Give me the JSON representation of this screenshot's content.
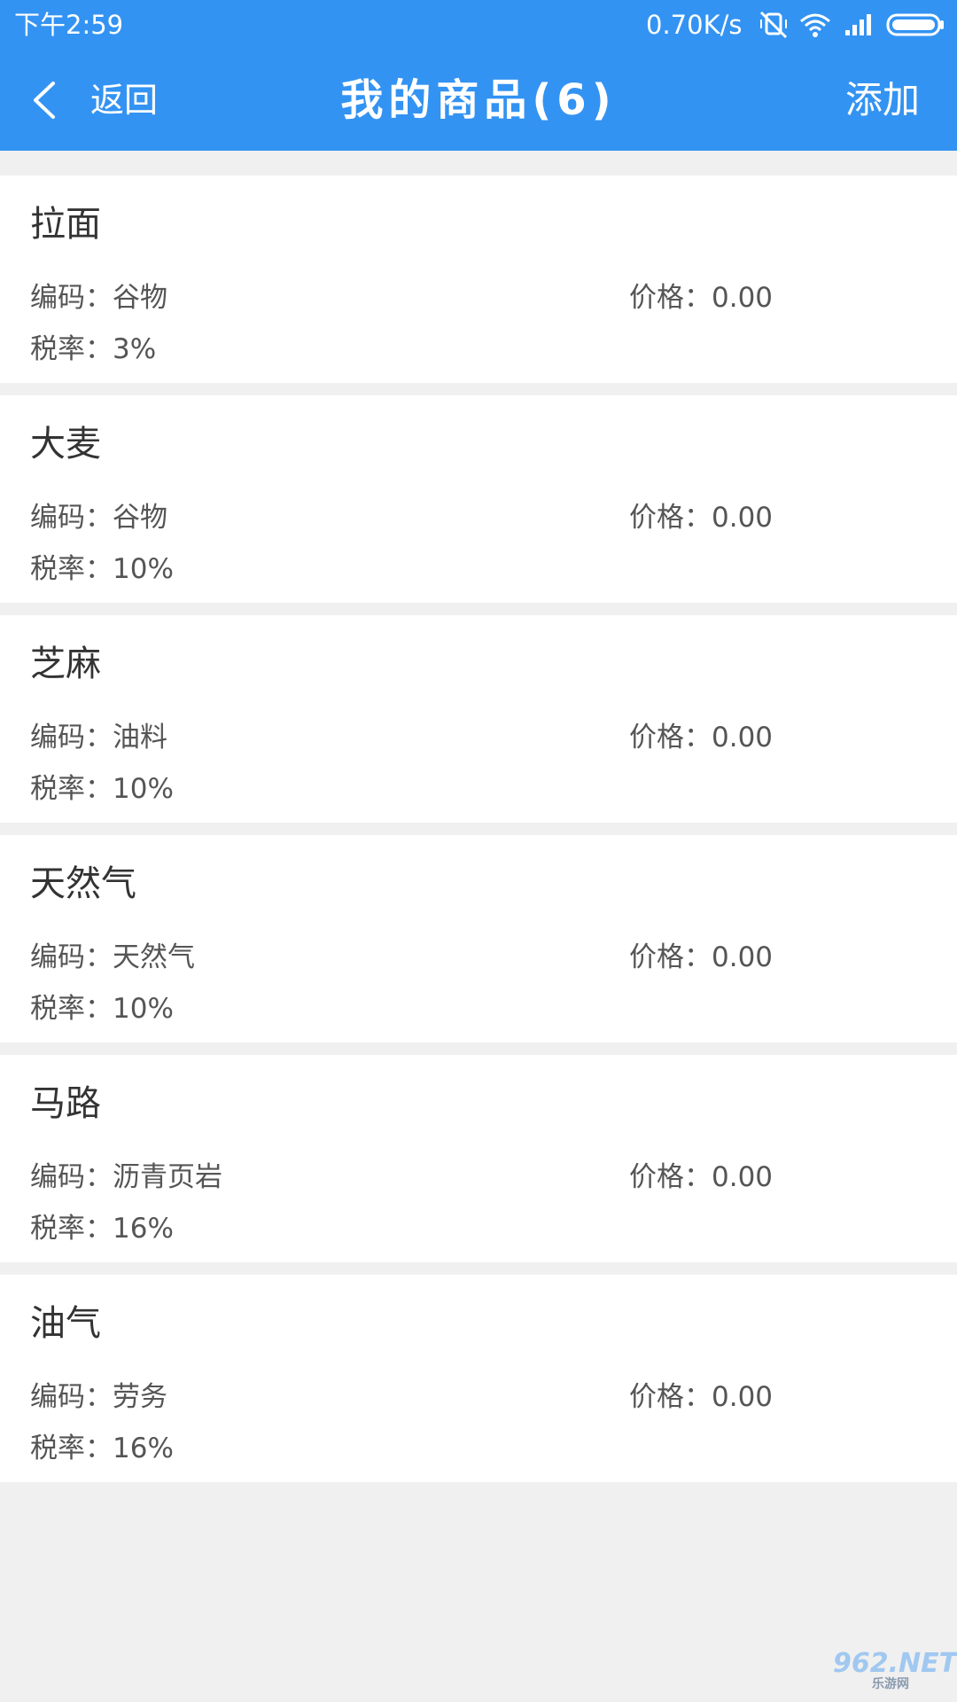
{
  "status_bar": {
    "time": "下午2:59",
    "network_speed": "0.70K/s",
    "icons": [
      "muted-vibrate-icon",
      "wifi-icon",
      "signal-icon",
      "battery-icon"
    ]
  },
  "header": {
    "back_label": "返回",
    "title": "我的商品(6)",
    "add_label": "添加"
  },
  "labels": {
    "code_prefix": "编码：",
    "price_prefix": "价格：",
    "tax_prefix": "税率："
  },
  "products": [
    {
      "name": "拉面",
      "code": "谷物",
      "price": "0.00",
      "tax": "3%"
    },
    {
      "name": "大麦",
      "code": "谷物",
      "price": "0.00",
      "tax": "10%"
    },
    {
      "name": "芝麻",
      "code": "油料",
      "price": "0.00",
      "tax": "10%"
    },
    {
      "name": "天然气",
      "code": "天然气",
      "price": "0.00",
      "tax": "10%"
    },
    {
      "name": "马路",
      "code": "沥青页岩",
      "price": "0.00",
      "tax": "16%"
    },
    {
      "name": "油气",
      "code": "劳务",
      "price": "0.00",
      "tax": "16%"
    }
  ],
  "watermark": {
    "main": "962.NET",
    "sub": "乐游网"
  },
  "colors": {
    "header_bg": "#3393f2",
    "page_bg": "#f0f0f0",
    "card_bg": "#ffffff"
  }
}
